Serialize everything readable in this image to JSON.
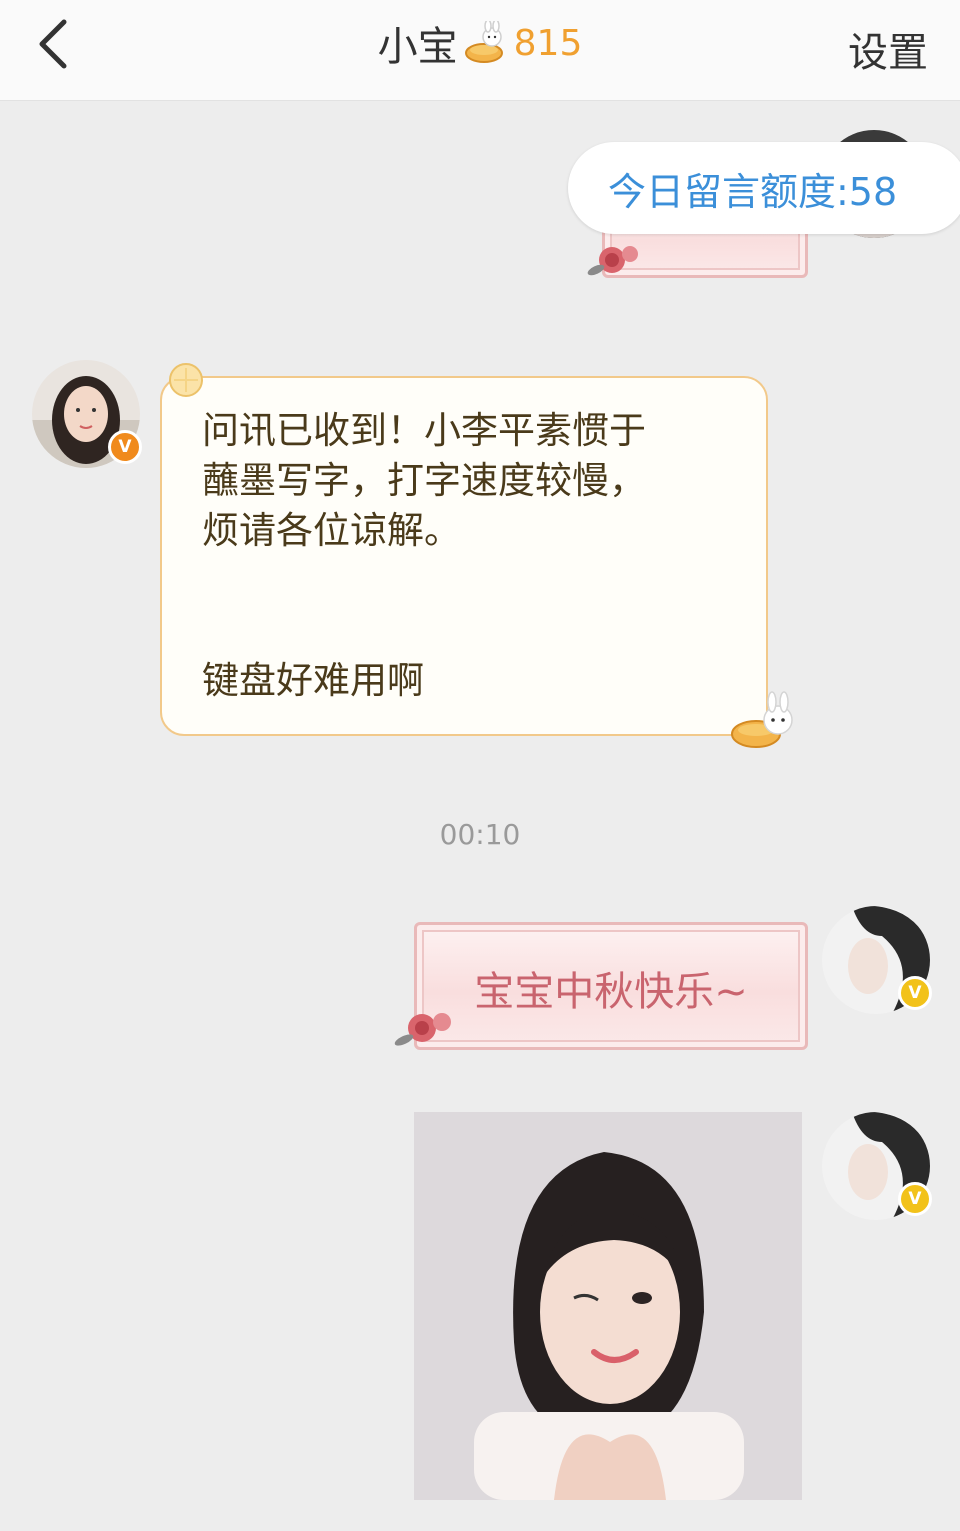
{
  "header": {
    "title": "小宝",
    "badge_count": "815",
    "settings_label": "设置"
  },
  "chat": {
    "quota_text": "今日留言额度:58",
    "received_message": "问讯已收到！小李平素惯于\n蘸墨写字，打字速度较慢，\n烦请各位谅解。\n\n\n键盘好难用啊",
    "timestamp": "00:10",
    "sent_message": "宝宝中秋快乐~",
    "verified_badge_glyph": "V"
  },
  "colors": {
    "accent_orange": "#f0a030",
    "quota_blue": "#3b8fd9",
    "greeting_pink": "#c9646e",
    "verified_orange": "#f08a1c",
    "verified_gold": "#f2c21a"
  },
  "icons": [
    "back-arrow-icon",
    "bunny-mooncake-icon",
    "verified-v-icon",
    "rose-decoration-icon"
  ]
}
